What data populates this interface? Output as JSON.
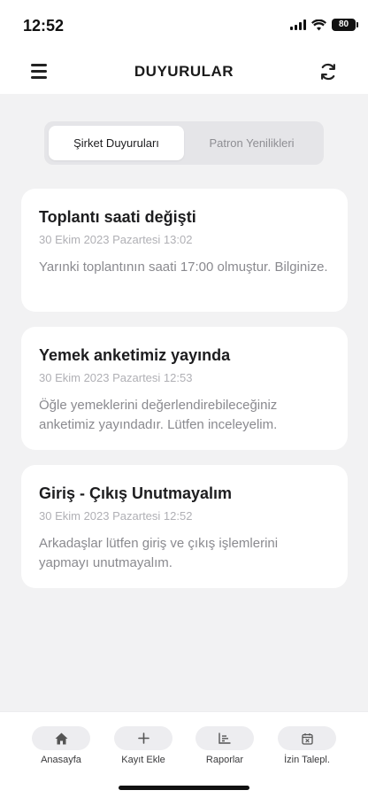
{
  "status_bar": {
    "time": "12:52",
    "battery": "80"
  },
  "header": {
    "title": "DUYURULAR"
  },
  "segment": {
    "tabs": [
      "Şirket Duyuruları",
      "Patron Yenilikleri"
    ]
  },
  "announcements": [
    {
      "title": "Toplantı saati değişti",
      "date": "30 Ekim 2023 Pazartesi 13:02",
      "body": "Yarınki toplantının saati 17:00 olmuştur. Bilginize."
    },
    {
      "title": "Yemek anketimiz yayında",
      "date": "30 Ekim 2023 Pazartesi 12:53",
      "body": "Öğle yemeklerini değerlendirebileceğiniz anketimiz yayındadır. Lütfen inceleyelim."
    },
    {
      "title": "Giriş - Çıkış Unutmayalım",
      "date": "30 Ekim 2023 Pazartesi 12:52",
      "body": "Arkadaşlar lütfen giriş ve çıkış işlemlerini yapmayı unutmayalım."
    }
  ],
  "tab_bar": [
    {
      "label": "Anasayfa",
      "icon": "home-icon"
    },
    {
      "label": "Kayıt Ekle",
      "icon": "plus-icon"
    },
    {
      "label": "Raporlar",
      "icon": "bar-chart-icon"
    },
    {
      "label": "İzin Talepl.",
      "icon": "calendar-x-icon"
    }
  ]
}
